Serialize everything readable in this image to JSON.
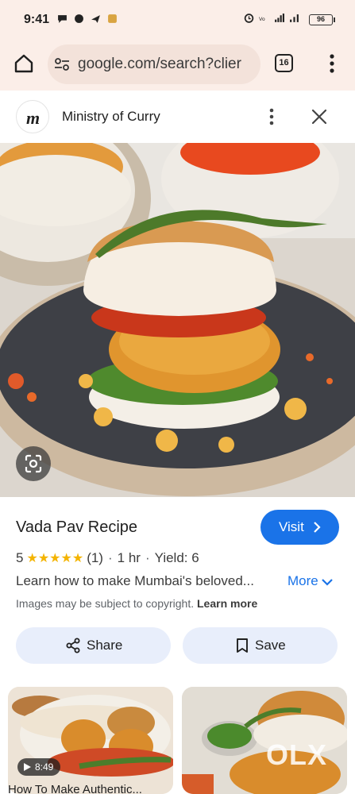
{
  "status_bar": {
    "time": "9:41",
    "battery": "96"
  },
  "browser": {
    "url": "google.com/search?clier",
    "tab_count": "16"
  },
  "header": {
    "site_name": "Ministry of Curry",
    "logo_letter": "m"
  },
  "result": {
    "title": "Vada Pav Recipe",
    "visit_label": "Visit",
    "rating": "5",
    "stars": "★★★★★",
    "review_count": "(1)",
    "time": "1 hr",
    "yield": "Yield: 6",
    "description": "Learn how to make Mumbai's beloved...",
    "more_label": "More",
    "copyright_text": "Images may be subject to copyright.",
    "learn_more": "Learn more",
    "share_label": "Share",
    "save_label": "Save"
  },
  "related": [
    {
      "duration": "8:49",
      "title": "How To Make Authentic..."
    }
  ],
  "watermark": "OLX",
  "colors": {
    "accent": "#1a73e8",
    "star": "#f4b400",
    "browser_bg": "#fbeee8"
  }
}
